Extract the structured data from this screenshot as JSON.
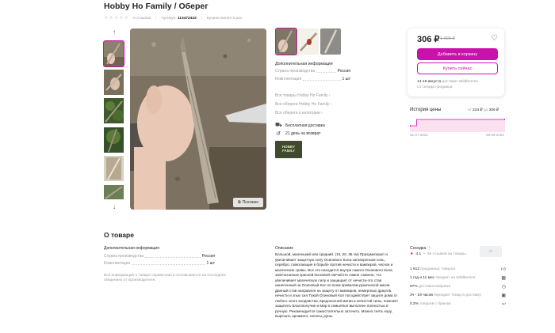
{
  "product": {
    "title": "Hobby Ho Family / Оберег",
    "reviews": "0 отзывов",
    "article_label": "Артикул:",
    "article": "113472443",
    "bought": "Купили менее 5 раз"
  },
  "gallery": {
    "up_icon": "arrow-up-icon",
    "down_icon": "arrow-down-icon",
    "similar_label": "Похожие"
  },
  "colors": {
    "accent": "#cb11ab",
    "price_chart": "#f3a6d5"
  },
  "info": {
    "heading": "Дополнительная информация",
    "params": [
      {
        "k": "Страна производства",
        "v": "Россия"
      },
      {
        "k": "Комплектация",
        "v": "1 шт"
      }
    ],
    "links": [
      "Все товары Hobby Ho Family",
      "Все обереги Hobby Ho Family",
      "Все обереги в категории"
    ],
    "delivery": [
      {
        "icon": "delivery-truck-icon",
        "text": "Бесплатная доставка"
      },
      {
        "icon": "return-icon",
        "text": "21 день на возврат"
      }
    ],
    "brand_logo_line1": "HOBBY",
    "brand_logo_line2": "FAMILY"
  },
  "buy_card": {
    "price": "306 ₽",
    "old_price": "1 000 ₽",
    "add_to_cart": "Добавить в корзину",
    "buy_now": "Купить сейчас",
    "delivery_date": "14-16 августа",
    "delivery_text": "доставит Wildberries",
    "delivery_from": "со склада продавца"
  },
  "price_history": {
    "title": "История цены",
    "from_label": "от",
    "from": "234 ₽",
    "to_label": "до",
    "to": "306 ₽",
    "date_start": "31.07.2022",
    "date_end": "09.08.2022"
  },
  "chart_data": {
    "type": "area",
    "x": [
      "31.07.2022",
      "09.08.2022"
    ],
    "values": [
      234,
      306
    ],
    "ylim": [
      234,
      306
    ]
  },
  "about": {
    "title": "О товаре",
    "info_heading": "Дополнительная информация",
    "params": [
      {
        "k": "Страна производства",
        "v": "Россия"
      },
      {
        "k": "Комплектация",
        "v": "1 шт"
      }
    ],
    "disclaimer": "Вся информация о товаре справочная и основывается на последних сведениях от производителя.",
    "desc_heading": "Описание",
    "description": "Большой, маленький или средний. (10, 20, 35 см) Призумножает и увеличивает защитную силу Осинового Кола-заговоренная соль, серебро, помогающие в борьбе против нечисти и вампиров, чеснок и магические травы. Все это находится внутри самого Осинового Кола, запечатанные красной восковой свечой.Но самое главное, что увеличивает магическую силу и защищает от нечисти-это став нанесенный на Осиновый Кол по всем правилам рунической магии. Данный став направлен на защиту от вампиров, немертвых драугов, нечисти и злых сил.Такой Осиновый Кол посодействует защите дома от любого злого колдовства, вредоносной магии и нечистой силы, поможет защитить Благополучие и Мир в семье!Кол выполнен полностью в ручную. Рекомендуется самостоятельно заточить. Можно снять кору, вырезать орнамент, сигилы, руны."
  },
  "seller": {
    "heading": "Соседка",
    "rating": "4.1",
    "reviews": "96 отзывов на товары",
    "stats": [
      {
        "val": "1 612",
        "lbl": "проданных товаров",
        "icon": "thumbs-up-icon"
      },
      {
        "val": "1 год и 11 мес",
        "lbl": "продает на Wildberries",
        "icon": "calendar-icon"
      },
      {
        "val": "97%",
        "lbl": "доставок вовремя",
        "icon": "clock-icon"
      },
      {
        "val": "3ч - 19 часов",
        "lbl": "передает товар в доставку",
        "icon": "box-icon"
      },
      {
        "val": "0.2%",
        "lbl": "товаров с браком",
        "icon": "return-arrow-icon"
      }
    ]
  }
}
